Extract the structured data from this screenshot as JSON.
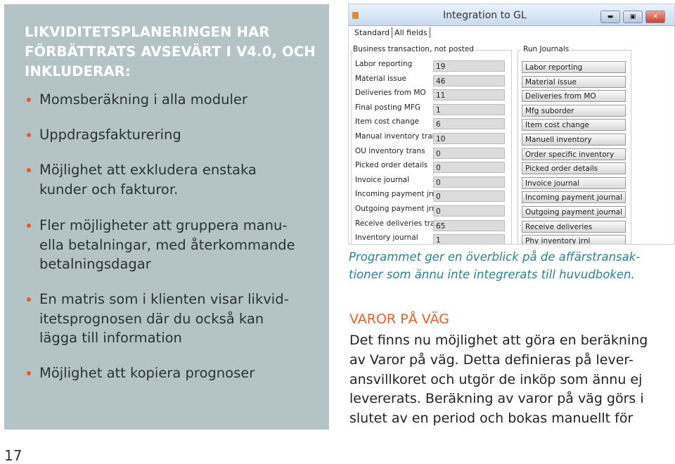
{
  "left_panel": {
    "heading_lines": [
      "LIKVIDITETSPLANERINGEN HAR",
      "FÖRBÄTTRATS AVSEVÄRT I V4.0, OCH",
      "INKLUDERAR:"
    ],
    "bullets": [
      {
        "lines": [
          "Momsberäkning i alla moduler"
        ]
      },
      {
        "lines": [
          "Uppdragsfakturering"
        ]
      },
      {
        "lines": [
          "Möjlighet att exkludera enstaka",
          "kunder och fakturor."
        ]
      },
      {
        "lines": [
          "Fler möjligheter att gruppera manu-",
          "ella betalningar, med återkommande",
          "betalningsdagar"
        ]
      },
      {
        "lines": [
          "En matris som i klienten visar likvid-",
          "itetsprognosen där du också kan",
          "lägga till information"
        ]
      },
      {
        "lines": [
          "Möjlighet att kopiera prognoser"
        ]
      }
    ],
    "bullet_color": "#e8582a"
  },
  "page_number": "17",
  "window": {
    "title": "Integration to GL",
    "tabs": [
      "Standard",
      "All fields"
    ],
    "left_group": "Business transaction, not posted",
    "right_group": "Run Journals",
    "rows": [
      {
        "label": "Labor reporting",
        "value": "19"
      },
      {
        "label": "Material issue",
        "value": "46"
      },
      {
        "label": "Deliveries from MO",
        "value": "11"
      },
      {
        "label": "Final posting MFG",
        "value": "1"
      },
      {
        "label": "Item cost change",
        "value": "6"
      },
      {
        "label": "Manual inventory trans",
        "value": "10"
      },
      {
        "label": "OU inventory trans",
        "value": "0"
      },
      {
        "label": "Picked order details",
        "value": "0"
      },
      {
        "label": "Invoice journal",
        "value": "0"
      },
      {
        "label": "Incoming payment jrnls",
        "value": "0"
      },
      {
        "label": "Outgoing payment jrnl:",
        "value": "0"
      },
      {
        "label": "Receive deliveries trans",
        "value": "65"
      },
      {
        "label": "Inventory journal",
        "value": "1"
      }
    ],
    "buttons": [
      "Labor reporting",
      "Material issue",
      "Deliveries from MO",
      "Mfg suborder",
      "Item cost change",
      "Manuell inventory",
      "Order specific inventory",
      "Picked order details",
      "Invoice journal",
      "Incoming payment journal",
      "Outgoing payment journal",
      "Receive deliveries",
      "Phy inventory jrnl"
    ]
  },
  "caption_lines": [
    "Programmet ger en överblick på de affärstransak-",
    "tioner som ännu inte integrerats till huvudboken."
  ],
  "section": {
    "heading": "VAROR PÅ VÄG",
    "body_lines": [
      "Det finns nu möjlighet att göra en beräkning",
      "av Varor på väg. Detta definieras på lever-",
      "ansvillkoret och utgör de inköp som ännu ej",
      "levererats. Beräkning av varor på väg görs i",
      "slutet av en period och bokas manuellt för"
    ]
  }
}
